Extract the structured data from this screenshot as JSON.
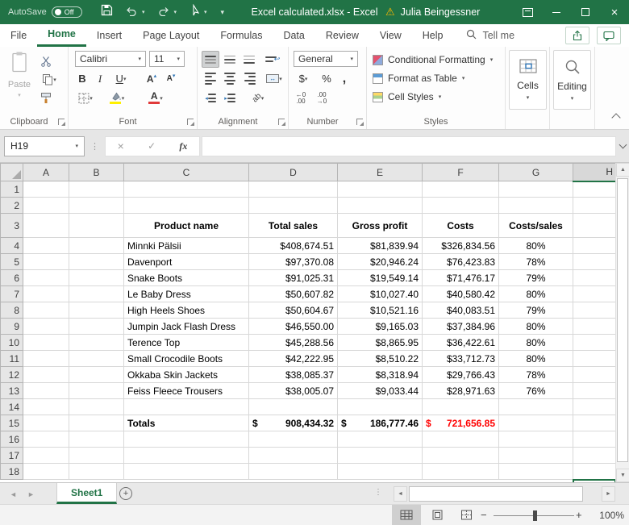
{
  "colors": {
    "excel_green": "#217346",
    "header_light": "#BDD7EE",
    "header_dark": "#5B9BD5",
    "costs_total": "#FF0000"
  },
  "title_bar": {
    "autosave_label": "AutoSave",
    "autosave_state": "Off",
    "title": "Excel calculated.xlsx - Excel",
    "user": "Julia Beingessner"
  },
  "ribbon": {
    "tabs": [
      "File",
      "Home",
      "Insert",
      "Page Layout",
      "Formulas",
      "Data",
      "Review",
      "View",
      "Help"
    ],
    "tell_me": "Tell me",
    "clipboard": {
      "label": "Clipboard",
      "paste_label": "Paste"
    },
    "font": {
      "label": "Font",
      "name": "Calibri",
      "size": "11",
      "bold": "B",
      "italic": "I",
      "underline": "U",
      "grow": "A",
      "shrink": "A"
    },
    "alignment": {
      "label": "Alignment"
    },
    "number": {
      "label": "Number",
      "format": "General",
      "currency": "$",
      "percent": "%",
      "comma": ",",
      "dec_inc_top": "←0",
      "dec_inc_bottom": ".00",
      "dec_dec_top": ".00",
      "dec_dec_bottom": "→0"
    },
    "styles": {
      "label": "Styles",
      "conditional_formatting": "Conditional Formatting",
      "format_as_table": "Format as Table",
      "cell_styles": "Cell Styles"
    },
    "cells_label": "Cells",
    "editing_label": "Editing"
  },
  "formula_bar": {
    "name_box": "H19",
    "fx_label": "fx",
    "value": ""
  },
  "sheet": {
    "active_cell": "H19",
    "columns": [
      "A",
      "B",
      "C",
      "D",
      "E",
      "F",
      "G",
      "H"
    ],
    "rows": [
      "1",
      "2",
      "3",
      "4",
      "5",
      "6",
      "7",
      "8",
      "9",
      "10",
      "11",
      "12",
      "13",
      "14",
      "15",
      "16",
      "17",
      "18"
    ],
    "table": {
      "headers": {
        "product": "Product name",
        "total_sales": "Total sales",
        "gross_profit": "Gross profit",
        "costs": "Costs",
        "costs_sales": "Costs/sales"
      },
      "products": [
        {
          "name": "Minnki Pälsii",
          "total_sales": "$408,674.51",
          "gross_profit": "$81,839.94",
          "costs": "$326,834.56",
          "costs_sales": "80%"
        },
        {
          "name": "Davenport",
          "total_sales": "$97,370.08",
          "gross_profit": "$20,946.24",
          "costs": "$76,423.83",
          "costs_sales": "78%"
        },
        {
          "name": "Snake Boots",
          "total_sales": "$91,025.31",
          "gross_profit": "$19,549.14",
          "costs": "$71,476.17",
          "costs_sales": "79%"
        },
        {
          "name": "Le Baby Dress",
          "total_sales": "$50,607.82",
          "gross_profit": "$10,027.40",
          "costs": "$40,580.42",
          "costs_sales": "80%"
        },
        {
          "name": "High Heels Shoes",
          "total_sales": "$50,604.67",
          "gross_profit": "$10,521.16",
          "costs": "$40,083.51",
          "costs_sales": "79%"
        },
        {
          "name": "Jumpin Jack Flash Dress",
          "total_sales": "$46,550.00",
          "gross_profit": "$9,165.03",
          "costs": "$37,384.96",
          "costs_sales": "80%"
        },
        {
          "name": "Terence Top",
          "total_sales": "$45,288.56",
          "gross_profit": "$8,865.95",
          "costs": "$36,422.61",
          "costs_sales": "80%"
        },
        {
          "name": "Small Crocodile Boots",
          "total_sales": "$42,222.95",
          "gross_profit": "$8,510.22",
          "costs": "$33,712.73",
          "costs_sales": "80%"
        },
        {
          "name": "Okkaba Skin Jackets",
          "total_sales": "$38,085.37",
          "gross_profit": "$8,318.94",
          "costs": "$29,766.43",
          "costs_sales": "78%"
        },
        {
          "name": "Feiss Fleece Trousers",
          "total_sales": "$38,005.07",
          "gross_profit": "$9,033.44",
          "costs": "$28,971.63",
          "costs_sales": "76%"
        }
      ],
      "totals": {
        "label": "Totals",
        "currency": "$",
        "total_sales": "908,434.32",
        "gross_profit": "186,777.46",
        "costs": "721,656.85"
      }
    }
  },
  "sheet_tabs": {
    "active": "Sheet1"
  },
  "status_bar": {
    "zoom": "100%"
  }
}
